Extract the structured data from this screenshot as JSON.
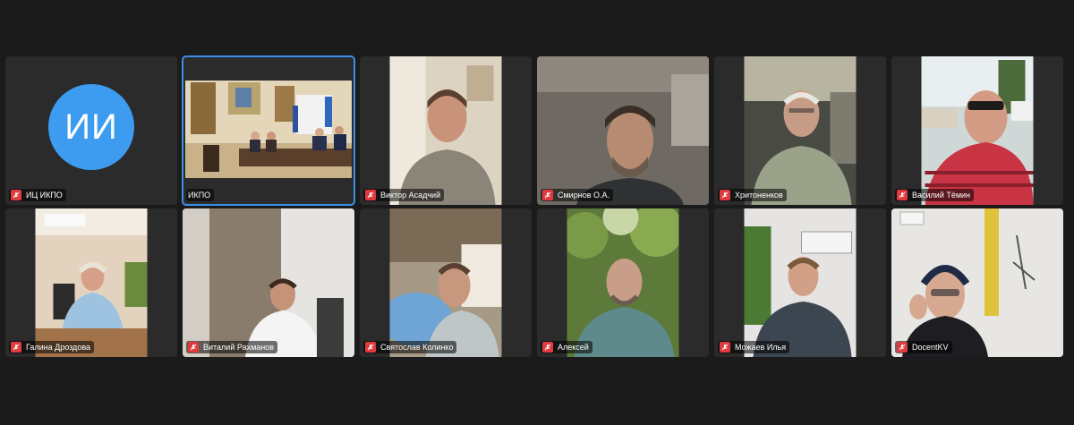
{
  "app": {
    "accent_color": "#3a8ee6",
    "muted_color": "#e0393e",
    "avatar_color": "#3d9cf0"
  },
  "participants": [
    {
      "name": "ИЦ ИКПО",
      "initials": "ИИ",
      "muted": true,
      "video": false
    },
    {
      "name": "ИКПО",
      "muted": false,
      "video": true,
      "active": true
    },
    {
      "name": "Виктор Асадчий",
      "muted": true,
      "video": true
    },
    {
      "name": "Смирнов О.А.",
      "muted": true,
      "video": true
    },
    {
      "name": "Хритоненков",
      "muted": true,
      "video": true
    },
    {
      "name": "Василий Тёмин",
      "muted": true,
      "video": true
    },
    {
      "name": "Галина Дроздова",
      "muted": true,
      "video": true
    },
    {
      "name": "Виталий Рахманов",
      "muted": true,
      "video": true
    },
    {
      "name": "Святослав Колинко",
      "muted": true,
      "video": true
    },
    {
      "name": "Алексей",
      "muted": true,
      "video": true
    },
    {
      "name": "Можаев Илья",
      "muted": true,
      "video": true
    },
    {
      "name": "DocentKV",
      "muted": true,
      "video": true
    }
  ],
  "icons": {
    "muted": "mic-off-icon"
  }
}
